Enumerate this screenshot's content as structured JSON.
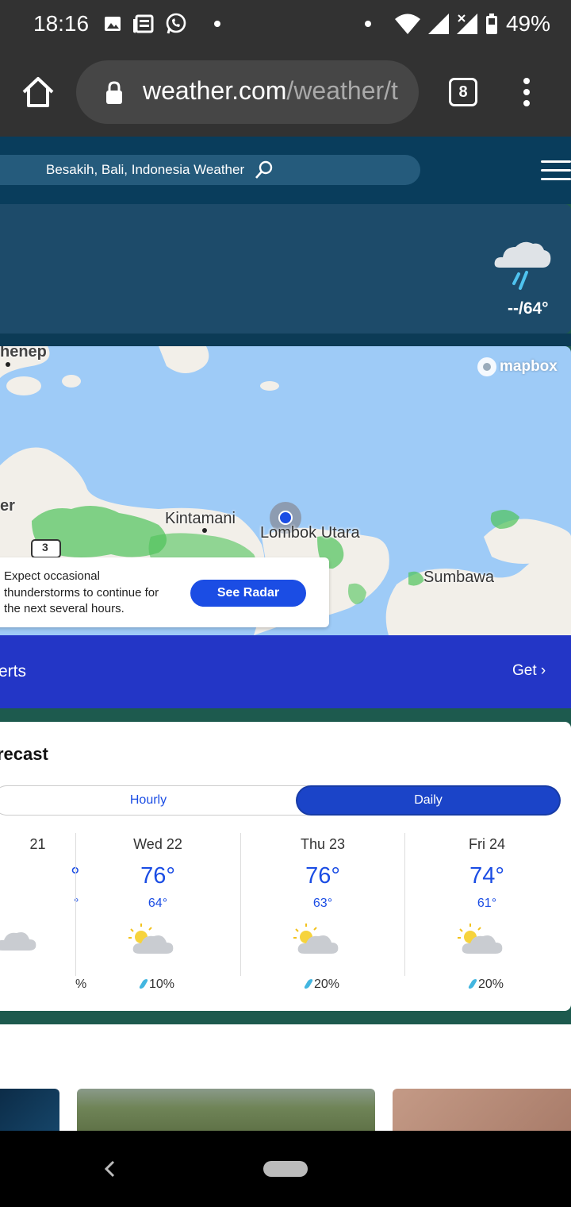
{
  "status_bar": {
    "time": "18:16",
    "battery": "49%"
  },
  "browser": {
    "url_domain": "weather.com",
    "url_path": "/weather/t",
    "tab_count": "8"
  },
  "header": {
    "search_text": "Besakih, Bali, Indonesia Weather"
  },
  "current": {
    "temps": "--/64°",
    "icon": "rain-cloud-icon"
  },
  "map": {
    "attribution": "mapbox",
    "labels": {
      "l1": "henep",
      "l2": "er",
      "kintamani": "Kintamani",
      "lombok": "Lombok Utara",
      "sumbawa": "Sumbawa",
      "road": "3"
    },
    "popup_text": "Expect occasional thunderstorms to continue for the next several hours.",
    "see_radar": "See Radar"
  },
  "alerts": {
    "label": "erts",
    "get": "Get ›"
  },
  "forecast": {
    "title": "recast",
    "tabs": {
      "hourly": "Hourly",
      "daily": "Daily"
    },
    "days": [
      {
        "name": "21",
        "hi": "°",
        "lo": "°",
        "precip": "%"
      },
      {
        "name": "Wed 22",
        "hi": "76°",
        "lo": "64°",
        "precip": "10%"
      },
      {
        "name": "Thu 23",
        "hi": "76°",
        "lo": "63°",
        "precip": "20%"
      },
      {
        "name": "Fri 24",
        "hi": "74°",
        "lo": "61°",
        "precip": "20%"
      }
    ]
  },
  "colors": {
    "header": "#093d5c",
    "accent": "#1b4de4",
    "alerts": "#2336c6"
  }
}
